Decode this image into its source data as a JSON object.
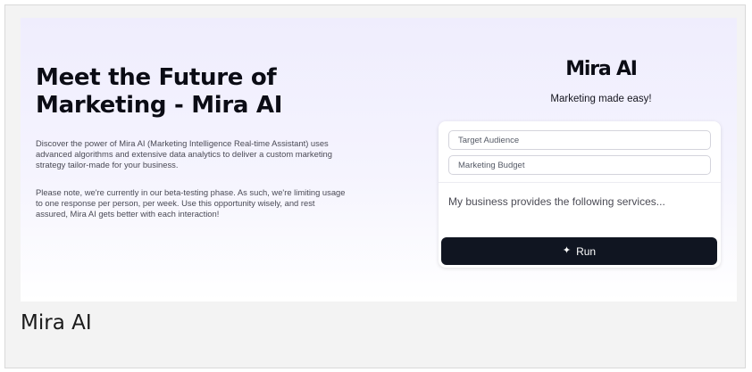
{
  "hero": {
    "title": "Meet the Future of Marketing - Mira AI",
    "description": "Discover the power of Mira AI (Marketing Intelligence Real-time Assistant) uses advanced algorithms and extensive data analytics to deliver a custom marketing strategy tailor-made for your business.",
    "note": "Please note, we're currently in our beta-testing phase. As such, we're limiting usage to one response per person, per week. Use this opportunity wisely, and rest assured, Mira AI gets better with each interaction!"
  },
  "brand": {
    "name": "Mira AI",
    "tagline": "Marketing made easy!"
  },
  "form": {
    "target_audience_placeholder": "Target Audience",
    "marketing_budget_placeholder": "Marketing Budget",
    "services_placeholder": "My business provides the following services...",
    "run_label": "Run",
    "run_icon": "sparkle-icon"
  },
  "caption": "Mira AI",
  "colors": {
    "button_bg": "#101521",
    "hero_gradient_top": "#efedfd",
    "text_dark": "#0b0c15"
  }
}
